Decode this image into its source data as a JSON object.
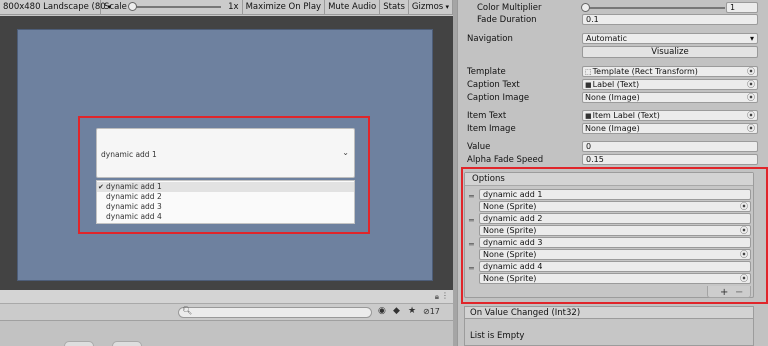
{
  "game_view": {
    "toolbar": {
      "resolution": "800x480 Landscape (80",
      "scale_label": "Scale",
      "scale_value": "1x",
      "maximize": "Maximize On Play",
      "mute": "Mute Audio",
      "stats": "Stats",
      "gizmos": "Gizmos"
    },
    "dropdown": {
      "caption": "dynamic add 1",
      "arrow": "⌄",
      "items": [
        {
          "label": "dynamic add 1",
          "selected": true
        },
        {
          "label": "dynamic add 2",
          "selected": false
        },
        {
          "label": "dynamic add 3",
          "selected": false
        },
        {
          "label": "dynamic add 4",
          "selected": false
        }
      ],
      "check": "✔"
    },
    "bottom": {
      "hidden_count": "17"
    }
  },
  "inspector": {
    "color_multiplier": {
      "label": "Color Multiplier",
      "value": "1"
    },
    "fade_duration": {
      "label": "Fade Duration",
      "value": "0.1"
    },
    "navigation": {
      "label": "Navigation",
      "value": "Automatic",
      "visualize": "Visualize"
    },
    "template": {
      "label": "Template",
      "value": "Template (Rect Transform)"
    },
    "caption_text": {
      "label": "Caption Text",
      "value": "Label (Text)"
    },
    "caption_image": {
      "label": "Caption Image",
      "value": "None (Image)"
    },
    "item_text": {
      "label": "Item Text",
      "value": "Item Label (Text)"
    },
    "item_image": {
      "label": "Item Image",
      "value": "None (Image)"
    },
    "value": {
      "label": "Value",
      "value": "0"
    },
    "alpha_fade_speed": {
      "label": "Alpha Fade Speed",
      "value": "0.15"
    },
    "options": {
      "header": "Options",
      "items": [
        {
          "text": "dynamic add 1",
          "image": "None (Sprite)"
        },
        {
          "text": "dynamic add 2",
          "image": "None (Sprite)"
        },
        {
          "text": "dynamic add 3",
          "image": "None (Sprite)"
        },
        {
          "text": "dynamic add 4",
          "image": "None (Sprite)"
        }
      ],
      "add": "+",
      "remove": "−"
    },
    "on_value_changed": {
      "header": "On Value Changed (Int32)",
      "empty": "List is Empty"
    }
  },
  "colors": {
    "highlight": "#e0252a",
    "canvas": "#6e819f",
    "game_bg": "#434343",
    "inspector_bg": "#c2c2c2"
  }
}
